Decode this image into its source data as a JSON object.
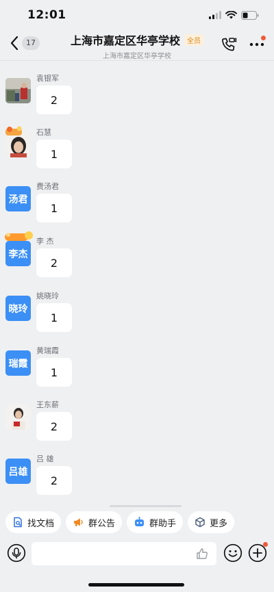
{
  "status_bar": {
    "time": "12:01"
  },
  "header": {
    "back_count": "17",
    "title": "上海市嘉定区华亭学校",
    "tag": "全员",
    "subtitle": "上海市嘉定区华亭学校"
  },
  "messages": [
    {
      "sender": "袁银军",
      "avatar_type": "photo",
      "text": "2"
    },
    {
      "sender": "石慧",
      "avatar_type": "photo",
      "text": "1"
    },
    {
      "sender": "费汤君",
      "avatar_type": "text",
      "avatar_text": "汤君",
      "text": "1"
    },
    {
      "sender": "李 杰",
      "avatar_type": "text",
      "avatar_text": "李杰",
      "avatar_badge": "月满中秋",
      "text": "2"
    },
    {
      "sender": "姚晓玲",
      "avatar_type": "text",
      "avatar_text": "晓玲",
      "text": "1"
    },
    {
      "sender": "黄瑞霞",
      "avatar_type": "text",
      "avatar_text": "瑞霞",
      "text": "1"
    },
    {
      "sender": "王东薪",
      "avatar_type": "photo",
      "text": "2"
    },
    {
      "sender": "吕 雄",
      "avatar_type": "text",
      "avatar_text": "吕雄",
      "text": "2"
    }
  ],
  "shortcuts": [
    {
      "label": "找文档",
      "icon": "document-search-icon"
    },
    {
      "label": "群公告",
      "icon": "megaphone-icon"
    },
    {
      "label": "群助手",
      "icon": "robot-icon"
    },
    {
      "label": "更多",
      "icon": "cube-icon"
    }
  ],
  "colors": {
    "accent": "#3b8ff5",
    "background": "#eff0f2",
    "badge_text": "#d9891c",
    "notify_dot": "#f05a3a"
  }
}
